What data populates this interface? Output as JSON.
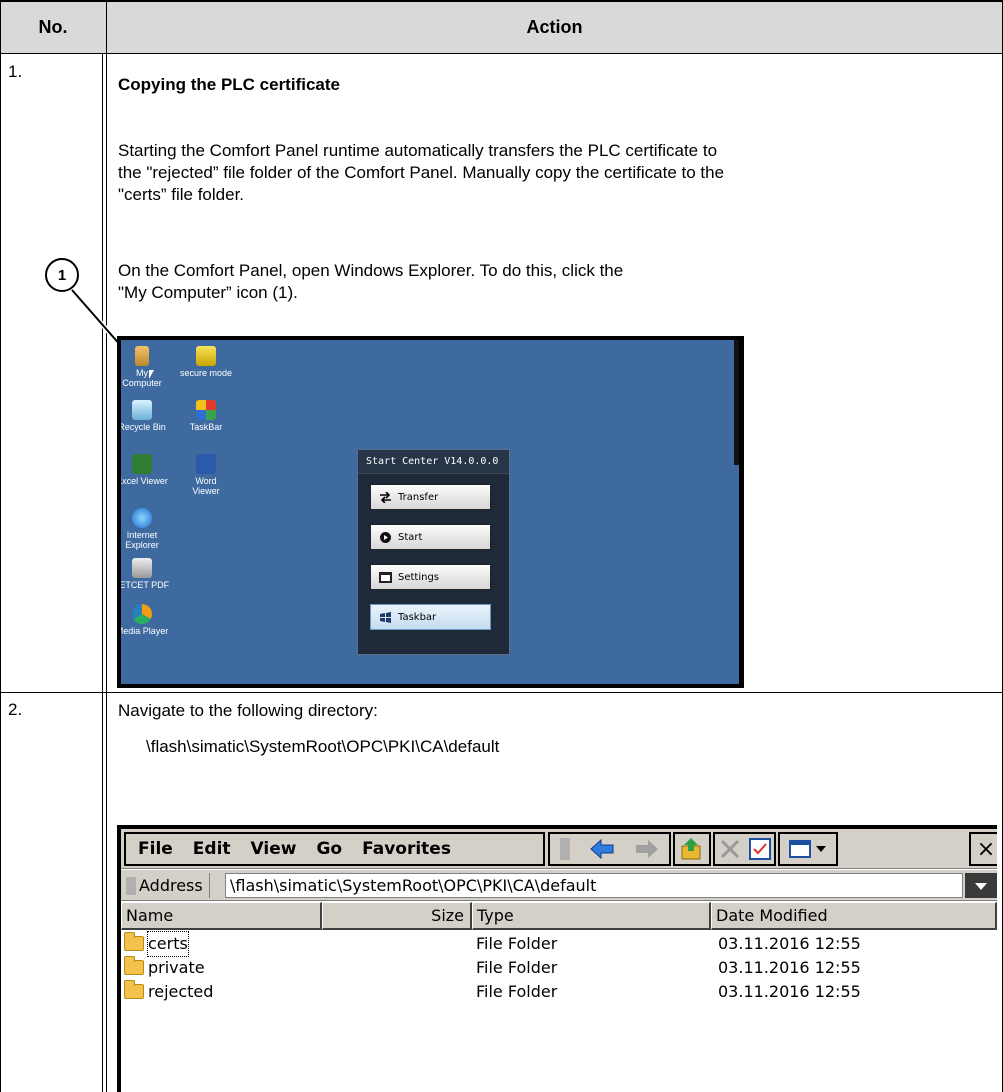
{
  "table": {
    "header_no": "No.",
    "header_action": "Action"
  },
  "step1": {
    "number": "1.",
    "title": "Copying the PLC certificate",
    "para1_line1": "Starting the Comfort Panel runtime automatically transfers the PLC certificate to",
    "para1_line2": "the \"rejected” file folder of the Comfort Panel. Manually copy the certificate to the",
    "para1_line3": "\"certs” file folder.",
    "para2_line1": "On the Comfort Panel, open Windows Explorer. To do this, click the",
    "para2_line2": "\"My Computer” icon (1).",
    "callout_label": "1"
  },
  "desktop": {
    "icons": [
      {
        "line1": "My",
        "line2": "Computer",
        "icon": "my-computer-icon"
      },
      {
        "line1": "secure mode",
        "line2": "",
        "icon": "lock-icon"
      },
      {
        "line1": "Recycle Bin",
        "line2": "",
        "icon": "recycle-bin-icon"
      },
      {
        "line1": "TaskBar",
        "line2": "",
        "icon": "windows-flag-icon"
      },
      {
        "line1": "Excel Viewer",
        "line2": "",
        "icon": "excel-icon"
      },
      {
        "line1": "Word",
        "line2": "Viewer",
        "icon": "word-icon"
      },
      {
        "line1": "Internet",
        "line2": "Explorer",
        "icon": "internet-explorer-icon"
      },
      {
        "line1": "JETCET PDF",
        "line2": "",
        "icon": "pdf-icon"
      },
      {
        "line1": "Media Player",
        "line2": "",
        "icon": "media-player-icon"
      }
    ],
    "start_center": {
      "title": "Start Center V14.0.0.0",
      "buttons": [
        "Transfer",
        "Start",
        "Settings",
        "Taskbar"
      ]
    }
  },
  "step2": {
    "number": "2.",
    "line1": "Navigate to the following directory:",
    "path": "\\flash\\simatic\\SystemRoot\\OPC\\PKI\\CA\\default"
  },
  "explorer": {
    "menu": [
      "File",
      "Edit",
      "View",
      "Go",
      "Favorites"
    ],
    "close_label": "×",
    "address_label": "Address",
    "address_value": "\\flash\\simatic\\SystemRoot\\OPC\\PKI\\CA\\default",
    "columns": [
      "Name",
      "Size",
      "Type",
      "Date Modified"
    ],
    "rows": [
      {
        "name": "certs",
        "size": "",
        "type": "File Folder",
        "modified": "03.11.2016 12:55"
      },
      {
        "name": "private",
        "size": "",
        "type": "File Folder",
        "modified": "03.11.2016 12:55"
      },
      {
        "name": "rejected",
        "size": "",
        "type": "File Folder",
        "modified": "03.11.2016 12:55"
      }
    ]
  }
}
